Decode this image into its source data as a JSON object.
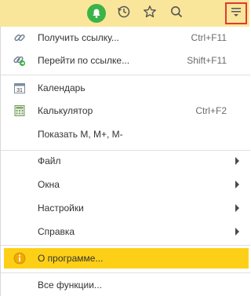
{
  "toolbar": {
    "icons": [
      "bell-icon",
      "history-icon",
      "star-icon",
      "search-icon",
      "menu-icon"
    ],
    "accent": "#f9e69a",
    "bell_color": "#3bb347",
    "highlight_border": "#e03a2f"
  },
  "menu": {
    "get_link": {
      "label": "Получить ссылку...",
      "shortcut": "Ctrl+F11"
    },
    "go_to_link": {
      "label": "Перейти по ссылке...",
      "shortcut": "Shift+F11"
    },
    "calendar": {
      "label": "Календарь",
      "icon_text": "31"
    },
    "calculator": {
      "label": "Калькулятор",
      "shortcut": "Ctrl+F2"
    },
    "show_memory": {
      "label": "Показать М, М+, М-"
    },
    "file": {
      "label": "Файл"
    },
    "windows": {
      "label": "Окна"
    },
    "settings": {
      "label": "Настройки"
    },
    "help": {
      "label": "Справка"
    },
    "about": {
      "label": "О программе...",
      "highlight": "#fdd017"
    },
    "all_functions": {
      "label": "Все функции..."
    }
  }
}
